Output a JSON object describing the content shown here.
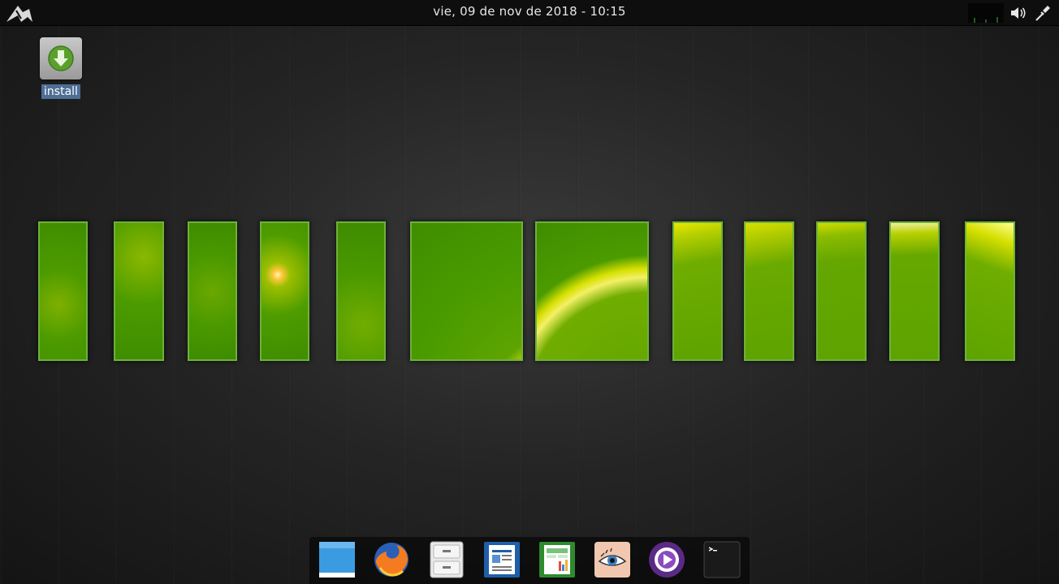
{
  "topbar": {
    "clock": "vie, 09 de nov de 2018 - 10:15",
    "menu_icon": "lxqt-menu-icon",
    "tray": [
      "volume-icon",
      "network-icon"
    ]
  },
  "desktop": {
    "icons": [
      {
        "label": "install",
        "icon": "download-arrow-icon"
      }
    ]
  },
  "wallpaper": {
    "accent": "#6db23a",
    "panels": 12
  },
  "dock": {
    "items": [
      {
        "name": "file-manager-icon"
      },
      {
        "name": "firefox-icon"
      },
      {
        "name": "file-cabinet-icon"
      },
      {
        "name": "writer-icon"
      },
      {
        "name": "calc-icon"
      },
      {
        "name": "image-viewer-icon"
      },
      {
        "name": "media-player-icon"
      },
      {
        "name": "terminal-icon"
      }
    ]
  }
}
